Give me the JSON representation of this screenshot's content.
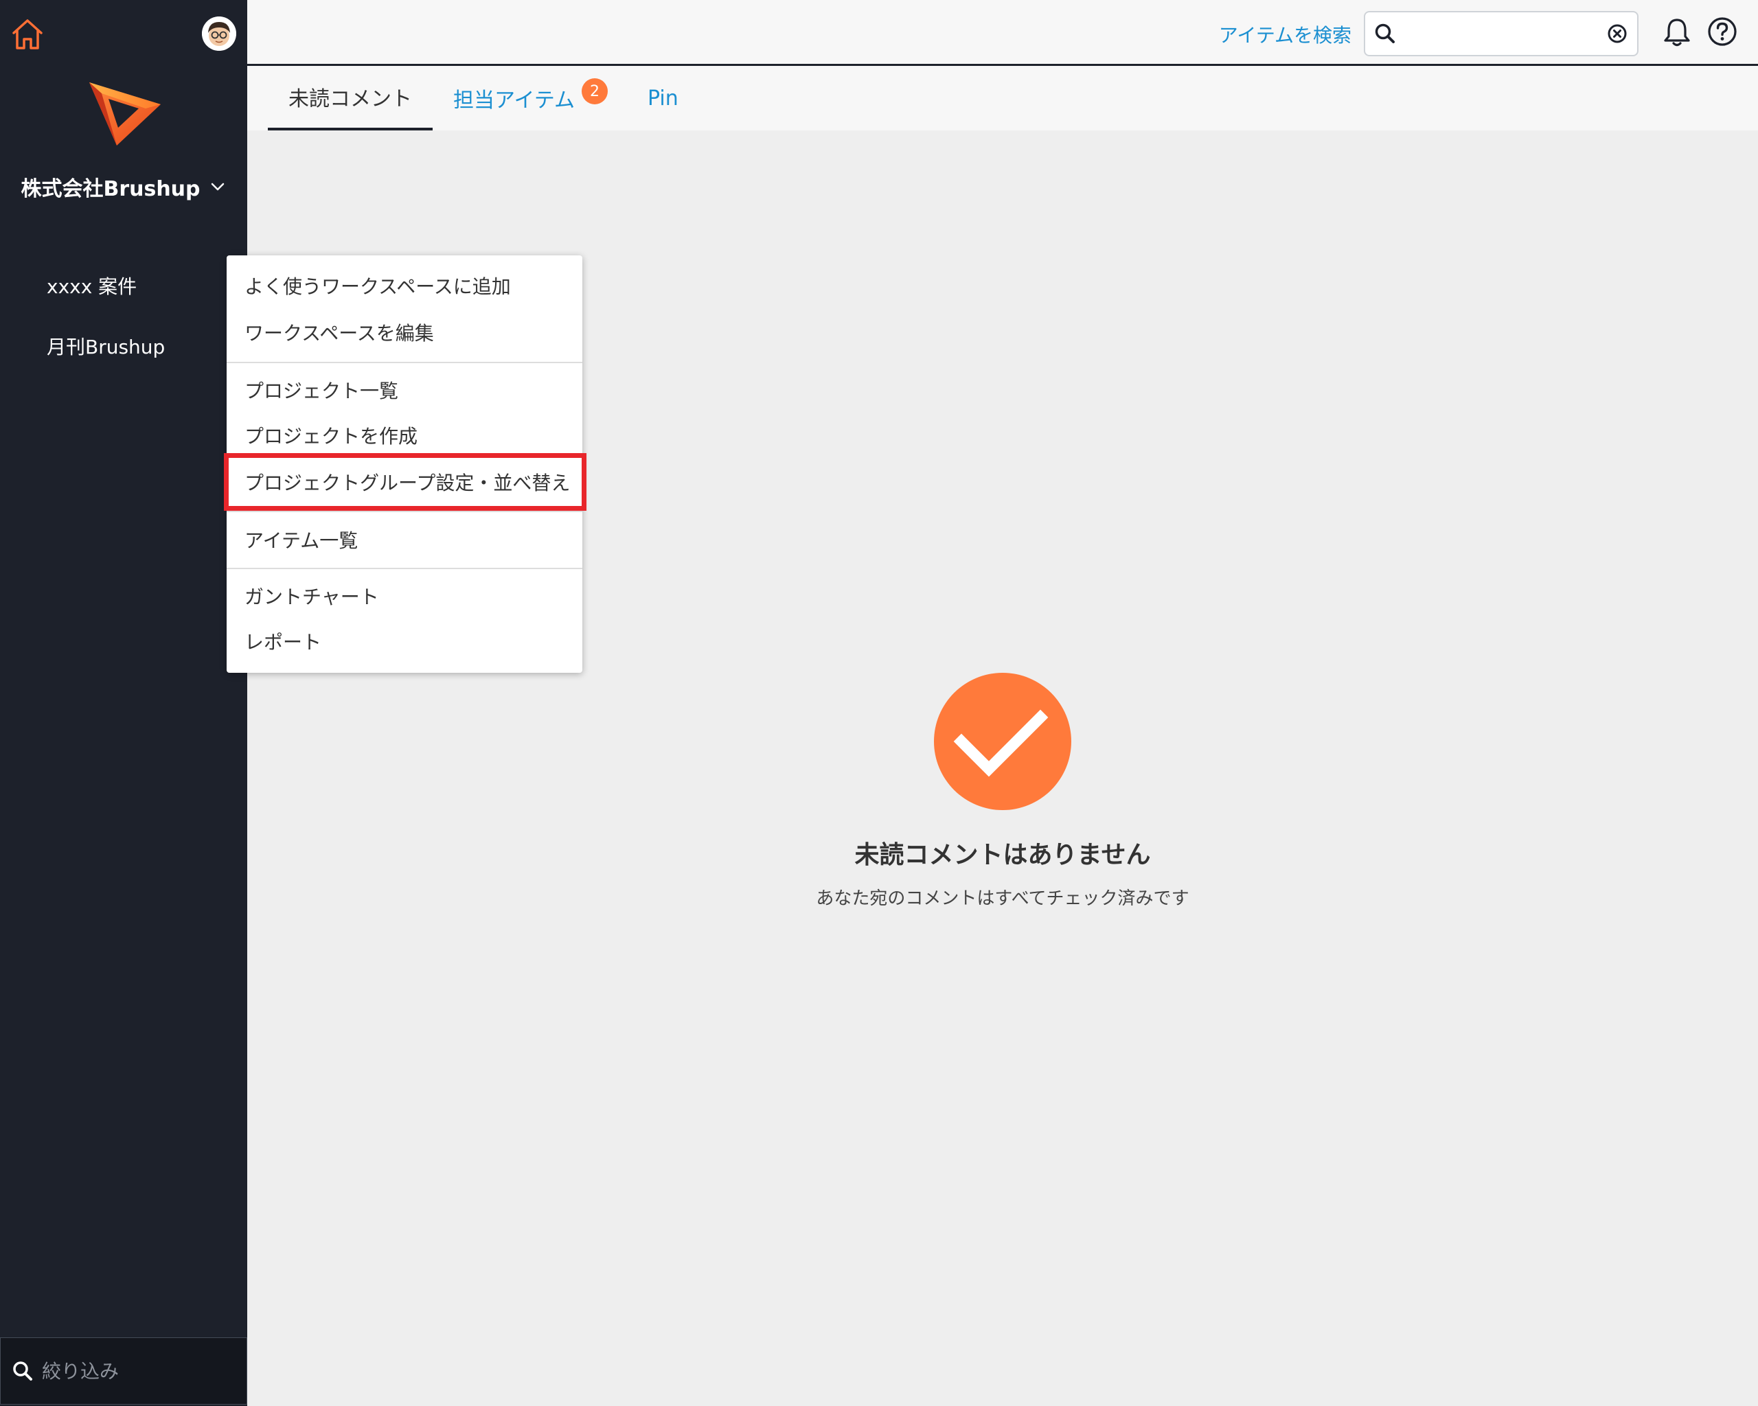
{
  "sidebar": {
    "org_name": "株式会社Brushup",
    "workspaces": [
      {
        "label": "xxxx 案件"
      },
      {
        "label": "月刊Brushup"
      }
    ],
    "filter_placeholder": "絞り込み"
  },
  "header": {
    "search_link_label": "アイテムを検索",
    "search_value": ""
  },
  "tabs": [
    {
      "label": "未読コメント",
      "active": true
    },
    {
      "label": "担当アイテム",
      "badge": "2"
    },
    {
      "label": "Pin"
    }
  ],
  "context_menu": {
    "items": [
      {
        "label": "よく使うワークスペースに追加"
      },
      {
        "label": "ワークスペースを編集"
      },
      {
        "label": "プロジェクト一覧"
      },
      {
        "label": "プロジェクトを作成"
      },
      {
        "label": "プロジェクトグループ設定・並べ替え",
        "highlighted": true
      },
      {
        "label": "アイテム一覧"
      },
      {
        "label": "ガントチャート"
      },
      {
        "label": "レポート"
      }
    ]
  },
  "empty_state": {
    "title": "未読コメントはありません",
    "subtitle": "あなた宛のコメントはすべてチェック済みです"
  },
  "colors": {
    "sidebar_bg": "#1d212b",
    "accent_orange": "#ff7a3b",
    "link_blue": "#1b8fd1",
    "highlight_red": "#e8262b",
    "main_bg": "#eeeeee"
  },
  "icons": [
    "home-icon",
    "avatar",
    "brand-logo",
    "chevron-down-icon",
    "search-icon",
    "clear-icon",
    "bell-icon",
    "help-icon",
    "check-circle-icon"
  ]
}
